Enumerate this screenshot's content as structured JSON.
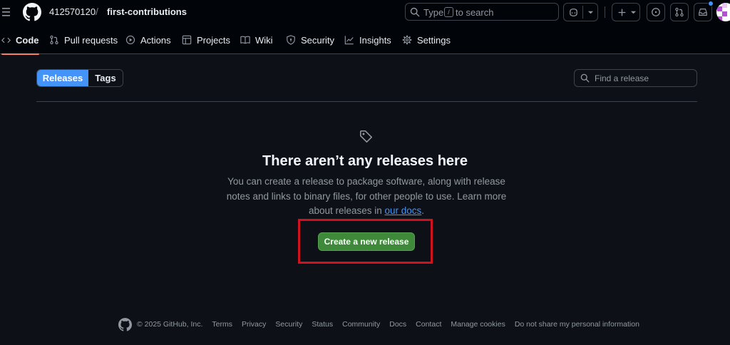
{
  "header": {
    "owner": "412570120",
    "separator": "/",
    "repo": "first-contributions",
    "search": {
      "prefix": "Type",
      "key": "/",
      "suffix": "to search"
    }
  },
  "nav": {
    "items": [
      {
        "label": "Code",
        "icon": "code-icon",
        "active": true
      },
      {
        "label": "Pull requests",
        "icon": "pull-request-icon"
      },
      {
        "label": "Actions",
        "icon": "play-icon"
      },
      {
        "label": "Projects",
        "icon": "table-icon"
      },
      {
        "label": "Wiki",
        "icon": "book-icon"
      },
      {
        "label": "Security",
        "icon": "shield-icon"
      },
      {
        "label": "Insights",
        "icon": "graph-icon"
      },
      {
        "label": "Settings",
        "icon": "gear-icon"
      }
    ]
  },
  "toolbar": {
    "releases_tab": "Releases",
    "tags_tab": "Tags",
    "find_placeholder": "Find a release"
  },
  "blankslate": {
    "title": "There aren’t any releases here",
    "desc_part1": "You can create a release to package software, along with release notes and links to binary files, for other people to use. Learn more about releases in ",
    "docs_link": "our docs",
    "desc_end": ".",
    "button": "Create a new release"
  },
  "footer": {
    "copyright": "© 2025 GitHub, Inc.",
    "links": [
      "Terms",
      "Privacy",
      "Security",
      "Status",
      "Community",
      "Docs",
      "Contact",
      "Manage cookies",
      "Do not share my personal information"
    ]
  },
  "colors": {
    "background": "#0d1117",
    "header_bg": "#010409",
    "accent_blue": "#4493f8",
    "primary_green": "#3e8a3a",
    "annotation_red": "#d0121e",
    "active_underline": "#f78166"
  }
}
